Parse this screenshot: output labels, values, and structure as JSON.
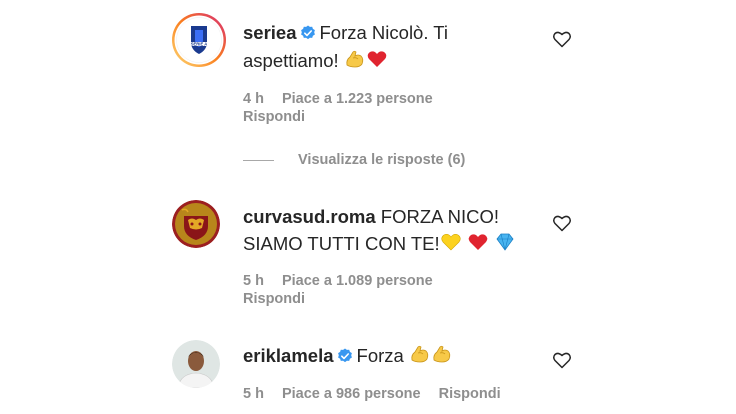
{
  "comments": [
    {
      "username": "seriea",
      "verified": true,
      "text_line1": "Forza Nicolò. Ti",
      "text_line2": "aspettiamo!",
      "emojis": [
        "flexed-biceps",
        "red-heart"
      ],
      "time": "4 h",
      "likes": "Piace a 1.223 persone",
      "reply": "Rispondi",
      "avatar_icon": "serie-a-logo",
      "avatar_label": "SERIE A"
    },
    {
      "username": "curvasud.roma",
      "verified": false,
      "text_line1": "FORZA NICO!",
      "text_line2": "SIAMO TUTTI CON TE!",
      "emojis": [
        "yellow-heart",
        "red-heart",
        "gem-stone"
      ],
      "time": "5 h",
      "likes": "Piace a 1.089 persone",
      "reply": "Rispondi",
      "avatar_icon": "as-roma-crest"
    },
    {
      "username": "eriklamela",
      "verified": true,
      "text_line1": "Forza",
      "emojis": [
        "flexed-biceps",
        "flexed-biceps"
      ],
      "time": "5 h",
      "likes": "Piace a 986 persone",
      "reply": "Rispondi",
      "avatar_icon": "profile-photo"
    }
  ],
  "view_replies": "Visualizza le risposte (6)",
  "colors": {
    "text": "#262626",
    "secondary": "#8e8e8e",
    "verified": "#3897f0",
    "story_ring_start": "#feda75",
    "story_ring_end": "#d62976"
  }
}
